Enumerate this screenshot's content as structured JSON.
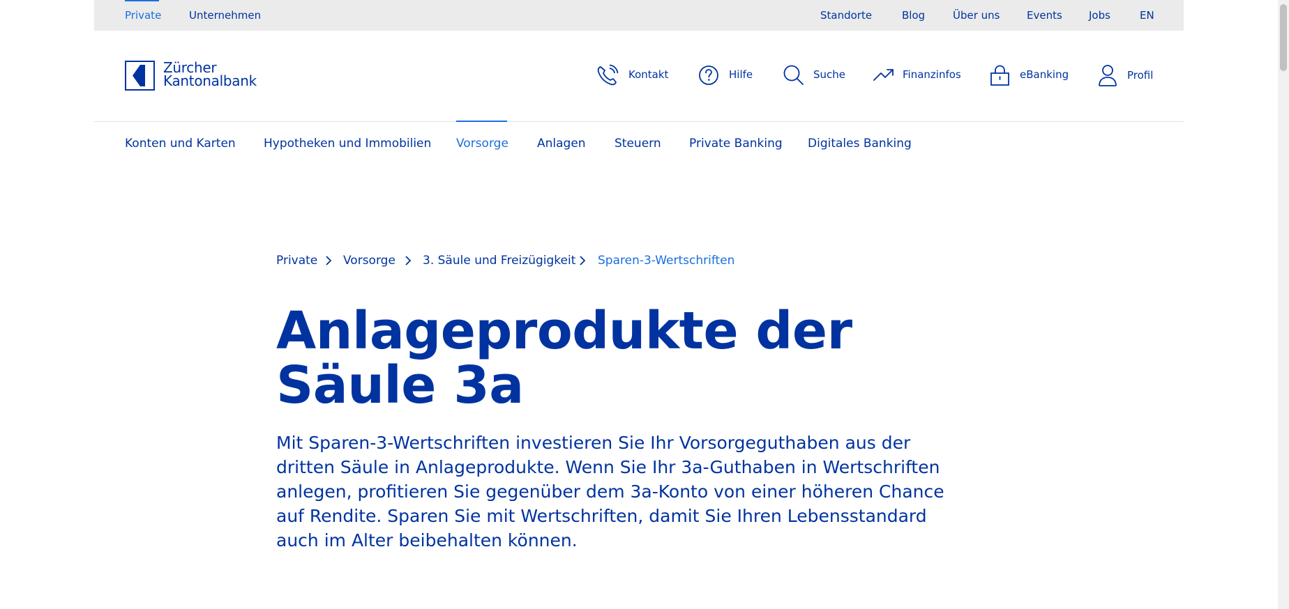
{
  "utility_nav": {
    "left": [
      {
        "label": "Private",
        "active": true
      },
      {
        "label": "Unternehmen",
        "active": false
      }
    ],
    "right": [
      "Standorte",
      "Blog",
      "Über uns",
      "Events",
      "Jobs",
      "EN"
    ]
  },
  "logo": {
    "line1": "Zürcher",
    "line2": "Kantonalbank"
  },
  "header_actions": [
    {
      "label": "Kontakt",
      "icon": "phone-icon"
    },
    {
      "label": "Hilfe",
      "icon": "help-icon"
    },
    {
      "label": "Suche",
      "icon": "search-icon"
    },
    {
      "label": "Finanzinfos",
      "icon": "trend-icon"
    },
    {
      "label": "eBanking",
      "icon": "lock-icon"
    },
    {
      "label": "Profil",
      "icon": "user-icon"
    }
  ],
  "main_nav": [
    {
      "label": "Konten und Karten",
      "active": false
    },
    {
      "label": "Hypotheken und Immobilien",
      "active": false
    },
    {
      "label": "Vorsorge",
      "active": true
    },
    {
      "label": "Anlagen",
      "active": false
    },
    {
      "label": "Steuern",
      "active": false
    },
    {
      "label": "Private Banking",
      "active": false
    },
    {
      "label": "Digitales Banking",
      "active": false
    }
  ],
  "breadcrumb": [
    "Private",
    "Vorsorge",
    "3. Säule und Freizügigkeit",
    "Sparen-3-Wertschriften"
  ],
  "title": "Anlageprodukte der Säule 3a",
  "lead": "Mit Sparen-3-Wertschriften investieren Sie Ihr Vorsorgeguthaben aus der dritten Säule in Anlageprodukte. Wenn Sie Ihr 3a-Guthaben in Wertschriften anlegen, profitieren Sie gegenüber dem 3a-Konto von einer höheren Chance auf Rendite. Sparen Sie mit Wertschriften, damit Sie Ihren Lebensstandard auch im Alter beibehalten können.",
  "colors": {
    "brand": "#0033a0",
    "active": "#1a6fe0",
    "utility_bg": "#ebebeb"
  }
}
